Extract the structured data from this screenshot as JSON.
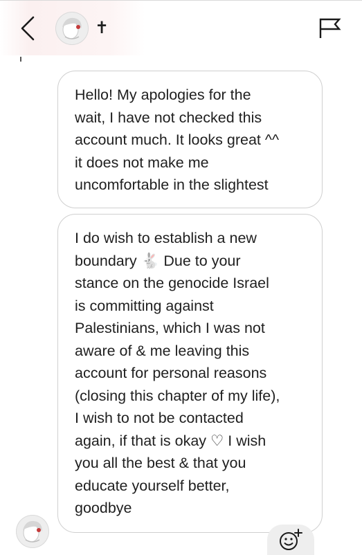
{
  "header": {
    "username": "✝",
    "icons": {
      "back": "chevron-left-icon",
      "report": "flag-icon"
    }
  },
  "messages": [
    {
      "text": "Hello! My apologies for the\nwait, I have not checked this\naccount much. It looks great ^^\nit does not make me\nuncomfortable in the slightest"
    },
    {
      "text": "I do wish to establish a new\nboundary 🐇 Due to your\nstance on the genocide Israel\nis committing against\nPalestinians, which I was not\naware of & me leaving this\naccount for personal reasons\n(closing this chapter of my life),\nI wish to not be contacted\nagain, if that is okay ♡ I wish\nyou all the best & that you\neducate yourself better,\ngoodbye"
    }
  ],
  "actions": {
    "react_icon": "add-reaction-icon"
  },
  "colors": {
    "bubble_border": "#cfcfcf",
    "text": "#1f1f1f",
    "react_bg": "#eeeeee"
  }
}
